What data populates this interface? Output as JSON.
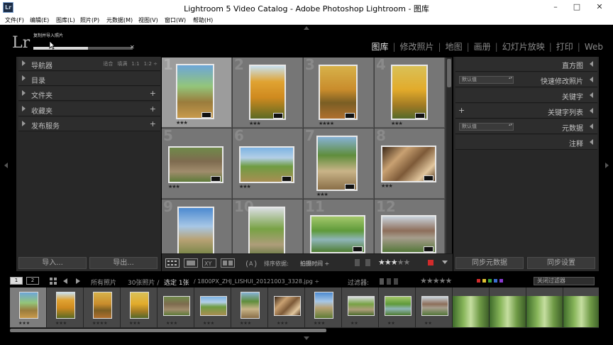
{
  "window": {
    "title": "Lightroom 5 Video Catalog - Adobe Photoshop Lightroom - 图库",
    "app_icon": "Lr"
  },
  "menu": [
    "文件(F)",
    "编辑(E)",
    "图库(L)",
    "照片(P)",
    "元数据(M)",
    "视图(V)",
    "窗口(W)",
    "帮助(H)"
  ],
  "identity": {
    "logo": "Lr",
    "progress_label": "复制并导入照片",
    "progress_fraction": 0.55,
    "modules": [
      "图库",
      "修改照片",
      "地图",
      "画册",
      "幻灯片放映",
      "打印",
      "Web"
    ],
    "active_module": "图库"
  },
  "left_panel": {
    "sections": [
      {
        "label": "导航器",
        "has_plus": false
      },
      {
        "label": "目录",
        "has_plus": false
      },
      {
        "label": "文件夹",
        "has_plus": true
      },
      {
        "label": "收藏夹",
        "has_plus": true
      },
      {
        "label": "发布服务",
        "has_plus": true
      }
    ],
    "plus_glyph": "+",
    "navigator_options": [
      "适合",
      "填满",
      "1:1",
      "1:2 ÷"
    ],
    "import_button": "导入...",
    "export_button": "导出..."
  },
  "grid": {
    "cells": [
      {
        "num": "1",
        "stars": "★★★",
        "photo": "p-hiker",
        "selected": true
      },
      {
        "num": "2",
        "stars": "★★★",
        "photo": "p-gold1",
        "selected": false
      },
      {
        "num": "3",
        "stars": "★★★★",
        "photo": "p-gold2",
        "selected": false
      },
      {
        "num": "4",
        "stars": "★★★",
        "photo": "p-gold3",
        "selected": false
      },
      {
        "num": "5",
        "stars": "★★★",
        "photo": "p-ruin",
        "selected": false
      },
      {
        "num": "6",
        "stars": "★★★",
        "photo": "p-mtn",
        "selected": false
      },
      {
        "num": "7",
        "stars": "★★★",
        "photo": "p-path",
        "selected": false
      },
      {
        "num": "8",
        "stars": "★★★",
        "photo": "p-nuts",
        "selected": false
      },
      {
        "num": "9",
        "stars": "",
        "photo": "p-cliff",
        "selected": false
      },
      {
        "num": "10",
        "stars": "",
        "photo": "p-bridge",
        "selected": false
      },
      {
        "num": "11",
        "stars": "",
        "photo": "p-river",
        "selected": false
      },
      {
        "num": "12",
        "stars": "",
        "photo": "p-house",
        "selected": false
      }
    ]
  },
  "toolbar": {
    "sort_label": "排序依据:",
    "sort_value": "拍摄时间 ÷",
    "rating_filled": "★★★",
    "rating_empty": "★★",
    "accent_red": "#d12b2b"
  },
  "right_panel": {
    "sections": [
      {
        "label": "直方图",
        "select": "",
        "plus": false
      },
      {
        "label": "快速修改照片",
        "select": "默认值",
        "plus": false
      },
      {
        "label": "关键字",
        "select": "",
        "plus": false
      },
      {
        "label": "关键字列表",
        "select": "",
        "plus": true
      },
      {
        "label": "元数据",
        "select": "默认值",
        "plus": false
      },
      {
        "label": "注释",
        "select": "",
        "plus": false
      }
    ],
    "plus_glyph": "+",
    "sync_metadata": "同步元数据",
    "sync_settings": "同步设置"
  },
  "filmbar": {
    "screen1": "1",
    "screen2": "2",
    "source": "所有照片",
    "count": "30张照片 /",
    "selected": "选定 1张",
    "filename": "/ 1800PX_ZHJ_LISHUI_20121003_3328.jpg ÷",
    "filter_label": "过滤器:",
    "filter_stars": "★★★★★",
    "filter_value": "关闭过滤器",
    "swatch_colors": [
      "#d12b2b",
      "#e0c230",
      "#3aa53a",
      "#3a6fd1",
      "#8a3ad1"
    ]
  },
  "filmstrip": {
    "thumbs": [
      {
        "photo": "p-hiker",
        "stars": "★★★",
        "selected": true
      },
      {
        "photo": "p-gold1",
        "stars": "★★★",
        "selected": false
      },
      {
        "photo": "p-gold2",
        "stars": "★★★★",
        "selected": false
      },
      {
        "photo": "p-gold3",
        "stars": "★★★",
        "selected": false
      },
      {
        "photo": "p-ruin",
        "stars": "★★★",
        "selected": false
      },
      {
        "photo": "p-mtn",
        "stars": "★★★",
        "selected": false
      },
      {
        "photo": "p-path",
        "stars": "★★★",
        "selected": false
      },
      {
        "photo": "p-nuts",
        "stars": "★★★",
        "selected": false
      },
      {
        "photo": "p-cliff",
        "stars": "★★★",
        "selected": false
      },
      {
        "photo": "p-bridge",
        "stars": "★★",
        "selected": false
      },
      {
        "photo": "p-river",
        "stars": "★★",
        "selected": false
      },
      {
        "photo": "p-house",
        "stars": "★★",
        "selected": false
      },
      {
        "photo": "p-green",
        "stars": "",
        "selected": false
      },
      {
        "photo": "p-green",
        "stars": "",
        "selected": false
      },
      {
        "photo": "p-green",
        "stars": "",
        "selected": false
      },
      {
        "photo": "p-green",
        "stars": "",
        "selected": false
      }
    ]
  }
}
